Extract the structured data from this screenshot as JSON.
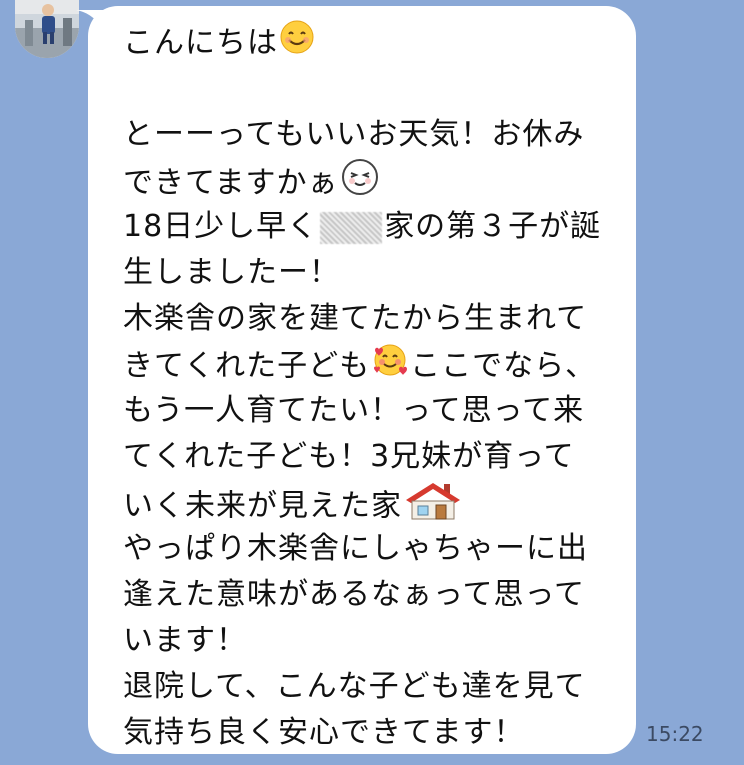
{
  "chat": {
    "message": {
      "lines": [
        "こんにちは",
        "",
        "とーーってもいいお天気！お休み",
        "できてますかぁ",
        "18日少し早く",
        "家の第３子が誕",
        "生しましたー！",
        "木楽舎の家を建てたから生まれて",
        "きてくれた子ども",
        "ここでなら、",
        "もう一人育てたい！って思って来",
        "てくれた子ども！3兄妹が育って",
        "いく未来が見えた家",
        "やっぱり木楽舎にしゃちゃーに出",
        "逢えた意味があるなぁって思って",
        "います！",
        "退院して、こんな子ども達を見て",
        "気持ち良く安心できてます！"
      ],
      "emojis": [
        "smiling-face",
        "squinting-face",
        "smiling-face-with-hearts",
        "house"
      ],
      "timestamp": "15:22"
    },
    "colors": {
      "background": "#8aa8d6",
      "bubble": "#ffffff",
      "text": "#111111",
      "timestamp": "#3b4a63"
    }
  }
}
